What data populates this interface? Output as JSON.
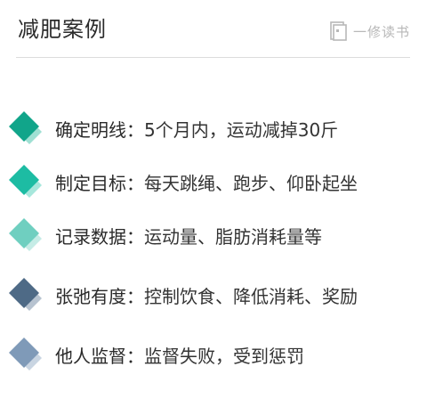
{
  "header": {
    "title": "减肥案例",
    "brand": "一修读书"
  },
  "colors": {
    "divider": "#dcdcdc",
    "brand_gray": "#b8b8b8"
  },
  "items": [
    {
      "label": "确定明线：",
      "desc": "5个月内，运动减掉30斤",
      "color": "#11a58a",
      "shadow": "#9fe0d3"
    },
    {
      "label": "制定目标：",
      "desc": "每天跳绳、跑步、仰卧起坐",
      "color": "#1dbca3",
      "shadow": "#a7e7dc"
    },
    {
      "label": "记录数据：",
      "desc": "运动量、脂肪消耗量等",
      "color": "#6fcfc0",
      "shadow": "#c5ece6"
    },
    {
      "label": "张弛有度：",
      "desc": "控制饮食、降低消耗、奖励",
      "color": "#4e6a86",
      "shadow": "#b7c3d0"
    },
    {
      "label": "他人监督：",
      "desc": "监督失败，受到惩罚",
      "color": "#7f9ab8",
      "shadow": "#c9d5e2"
    }
  ]
}
